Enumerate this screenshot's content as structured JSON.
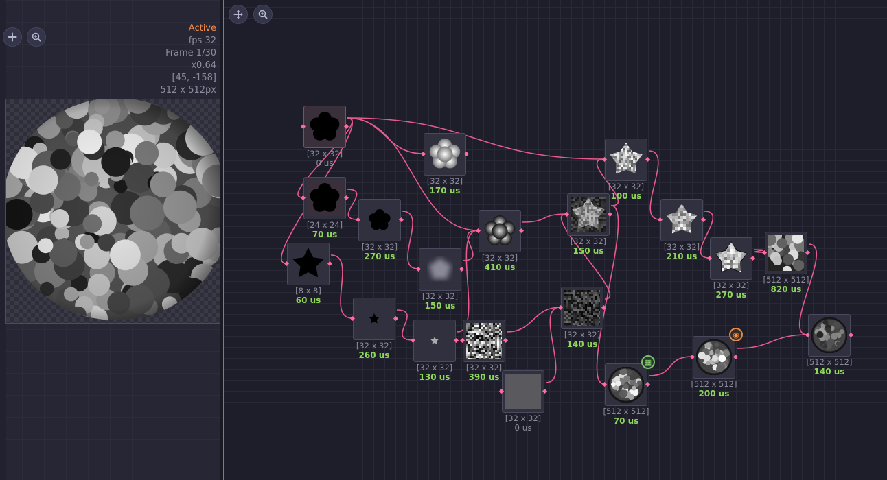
{
  "preview": {
    "status": "Active",
    "fps": "fps 32",
    "frame": "Frame 1/30",
    "zoom": "x0.64",
    "position": "[45, -158]",
    "size": "512 x 512px",
    "pan_icon": "move-cross-icon",
    "zoom_icon": "magnifier-plus-icon"
  },
  "graph": {
    "pan_icon": "move-cross-icon",
    "zoom_icon": "magnifier-plus-icon"
  },
  "colors": {
    "accent": "#f08a4b",
    "wire": "#e85a8e",
    "time": "#8fd65a"
  },
  "nodes": [
    {
      "size": "[32 x 32]",
      "time": "0 us",
      "thumb": "black-star"
    },
    {
      "size": "[32 x 32]",
      "time": "170 us",
      "thumb": "white-star-glow"
    },
    {
      "size": "[24 x 24]",
      "time": "70 us",
      "thumb": "black-star"
    },
    {
      "size": "[32 x 32]",
      "time": "270 us",
      "thumb": "black-star-small"
    },
    {
      "size": "[8 x 8]",
      "time": "60 us",
      "thumb": "black-pixel-star"
    },
    {
      "size": "[32 x 32]",
      "time": "150 us",
      "thumb": "blur-star"
    },
    {
      "size": "[32 x 32]",
      "time": "410 us",
      "thumb": "dark-star-glow"
    },
    {
      "size": "[32 x 32]",
      "time": "260 us",
      "thumb": "tiny-dark-star"
    },
    {
      "size": "[32 x 32]",
      "time": "130 us",
      "thumb": "tiny-light-star"
    },
    {
      "size": "[32 x 32]",
      "time": "390 us",
      "thumb": "noise"
    },
    {
      "size": "[32 x 32]",
      "time": "0 us",
      "thumb": "gray-solid"
    },
    {
      "size": "[32 x 32]",
      "time": "150 us",
      "thumb": "noisy-star"
    },
    {
      "size": "[32 x 32]",
      "time": "140 us",
      "thumb": "dark-noise"
    },
    {
      "size": "[32 x 32]",
      "time": "100 us",
      "thumb": "noisy-star-light"
    },
    {
      "size": "[32 x 32]",
      "time": "210 us",
      "thumb": "pixel-star"
    },
    {
      "size": "[32 x 32]",
      "time": "270 us",
      "thumb": "pixel-star-outline"
    },
    {
      "size": "[512 x 512]",
      "time": "820 us",
      "thumb": "voronoi"
    },
    {
      "size": "[512 x 512]",
      "time": "70 us",
      "thumb": "sphere"
    },
    {
      "size": "[512 x 512]",
      "time": "200 us",
      "thumb": "sphere"
    },
    {
      "size": "[512 x 512]",
      "time": "140 us",
      "thumb": "sphere-dark"
    }
  ],
  "badges": {
    "graph_badge": "grid-graph-icon",
    "preview_badge": "eye-icon"
  }
}
